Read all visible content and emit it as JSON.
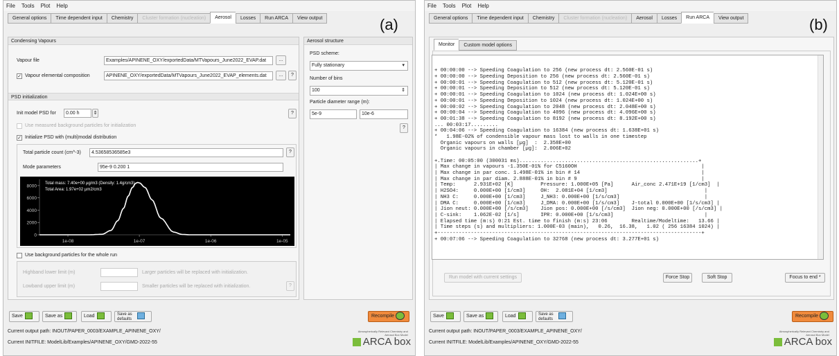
{
  "menu": [
    "File",
    "Tools",
    "Plot",
    "Help"
  ],
  "tabs_a": [
    {
      "label": "General options",
      "state": "normal"
    },
    {
      "label": "Time dependent input",
      "state": "normal"
    },
    {
      "label": "Chemistry",
      "state": "normal"
    },
    {
      "label": "Cluster formation (nucleation)",
      "state": "disabled"
    },
    {
      "label": "Aerosol",
      "state": "active"
    },
    {
      "label": "Losses",
      "state": "normal"
    },
    {
      "label": "Run ARCA",
      "state": "normal"
    },
    {
      "label": "View output",
      "state": "normal"
    }
  ],
  "tabs_b": [
    {
      "label": "General options",
      "state": "normal"
    },
    {
      "label": "Time dependent input",
      "state": "normal"
    },
    {
      "label": "Chemistry",
      "state": "normal"
    },
    {
      "label": "Cluster formation (nucleation)",
      "state": "disabled"
    },
    {
      "label": "Aerosol",
      "state": "normal"
    },
    {
      "label": "Losses",
      "state": "normal"
    },
    {
      "label": "Run ARCA",
      "state": "active"
    },
    {
      "label": "View output",
      "state": "normal"
    }
  ],
  "panel_labels": {
    "a": "(a)",
    "b": "(b)"
  },
  "aerosol": {
    "condensing_title": "Condensing Vapours",
    "vapour_file_label": "Vapour file",
    "vapour_file_value": "Examples/APINENE_OXY/exportedData/MTVapours_June2022_EVAP.dat",
    "vapour_elem_label": "Vapour elemental composition",
    "vapour_elem_value": "APINENE_OXY/exportedData/MTVapours_June2022_EVAP_elements.dat",
    "dots": "...",
    "help": "?",
    "psd_init_title": "PSD initialization",
    "init_model_label": "Init model PSD for",
    "init_model_value": "0.00 h",
    "use_measured": "Use measured background particles for initialization",
    "init_psd": "Initialize PSD with (multi)modal distribution",
    "total_count_label": "Total particle count (cm^-3)",
    "total_count_value": "4.53658536585e3",
    "mode_params_label": "Mode parameters",
    "mode_params_value": "95e-9 0.200 1",
    "use_background": "Use background particles for the whole run",
    "highband_label": "Highband lower limit (m)",
    "highband_note": "Larger particles will be replaced with initialization.",
    "lowband_label": "Lowband upper limit (m)",
    "lowband_note": "Smaller particles will be replaced with initialization.",
    "structure_title": "Aerosol structure",
    "psd_scheme_label": "PSD scheme:",
    "psd_scheme_value": "Fully stationary",
    "bins_label": "Number of bins",
    "bins_value": "100",
    "diam_range_label": "Particle diameter range (m):",
    "diam_min": "5e-9",
    "diam_max": "10e-6"
  },
  "chart_data": {
    "type": "line",
    "x_scale": "log",
    "xticks": [
      "1e-08",
      "1e-07",
      "1e-06",
      "1e-05"
    ],
    "yticks": [
      "0",
      "2000",
      "4000",
      "6000",
      "8000"
    ],
    "ylim": [
      0,
      9000
    ],
    "xlim": [
      4e-09,
      1.3e-05
    ],
    "annotations": [
      "Total mass: 7.40e+00 µg/m3 (Density: 1.4g/cm3)",
      "Total Area: 1.97e+02 µm2/cm3"
    ],
    "series": [
      {
        "x": [
          1e-08,
          2e-08,
          3e-08,
          4e-08,
          5e-08,
          6e-08,
          7e-08,
          8e-08,
          9e-08,
          9.5e-08,
          1e-07,
          1.2e-07,
          1.5e-07,
          2e-07,
          3e-07,
          4e-07,
          5e-07,
          7e-07,
          1e-06
        ],
        "values": [
          0,
          0,
          80,
          700,
          2300,
          4300,
          6300,
          7700,
          8400,
          8500,
          8430,
          7700,
          5700,
          2700,
          450,
          60,
          5,
          0,
          0
        ]
      }
    ],
    "grid": false,
    "background": "#000000",
    "line_color": "#ffffff"
  },
  "monitor": {
    "subtabs": [
      "Monitor",
      "Custom model options"
    ],
    "lines": [
      "+ 00:00:00 --> Speeding Coagulation to 256 (new process dt: 2.560E-01 s)",
      "+ 00:00:00 --> Speeding Deposition to 256 (new process dt: 2.560E-01 s)",
      "+ 00:00:01 --> Speeding Coagulation to 512 (new process dt: 5.120E-01 s)",
      "+ 00:00:01 --> Speeding Deposition to 512 (new process dt: 5.120E-01 s)",
      "+ 00:00:01 --> Speeding Coagulation to 1024 (new process dt: 1.024E+00 s)",
      "+ 00:00:01 --> Speeding Deposition to 1024 (new process dt: 1.024E+00 s)",
      "+ 00:00:02 --> Speeding Coagulation to 2048 (new process dt: 2.048E+00 s)",
      "+ 00:00:04 --> Speeding Coagulation to 4096 (new process dt: 4.096E+00 s)",
      "+ 00:01:38 --> Speeding Coagulation to 8192 (new process dt: 8.192E+00 s)",
      "... 00:03:17.........",
      "+ 00:04:06 --> Speeding Coagulation to 16384 (new process dt: 1.638E+01 s)",
      "*   1.98E-02% of condensible vapour mass lost to walls in one timestep",
      "  Organic vapours on walls [µg]  :  2.358E+00",
      "  Organic vapours in chamber [µg]:  2.006E+02",
      "",
      "+.Time: 00:05:00 (300031 ms)...........................................................+",
      "| Max change in vapours -1.350E-01% for C5160OH                                         |",
      "| Max change in par conc. 1.498E-01% in bin # 14                                        |",
      "| Max change in par diam. 2.888E-01% in bin # 9                                         |",
      "| Temp:      2.931E+02 [K]         Pressure: 1.000E+05 [Pa]      Air_conc 2.471E+19 [1/cm3]  |",
      "| H2SO4:     0.000E+00 [1/cm3]     OH:  2.081E+04 [1/cm3]                                |",
      "| NH3 C:     0.000E+00 [1/cm3]     J_NH3: 0.000E+00 [1/s/cm3]                            |",
      "| DMA C:     0.000E+00 [1/cm3]     J_DMA: 0.000E+00 [1/s/cm3]    J-total 0.000E+00 [1/s/cm3] |",
      "| Jion neut: 0.000E+00 [/s/cm3]    Jion pos: 0.000E+00 [/s/cm3]  Jion neg: 0.000E+00 [/s/cm3] |",
      "| C-sink:    1.062E-02 [1/s]       IPR: 0.000E+00 [1/s/cm3]                              |",
      "| Elapsed time (m:s) 0:21 Est. time to finish (m:s) 23:06        Realtime/Modeltime:   13.66 |",
      "| Time steps (s) and multipliers: 1.000E-03 (main),   0.26,  16.38,   1.02 ( 256 16384 1024) |",
      "+---------------------------------------------------------------------------------------+",
      "+ 00:07:06 --> Speeding Coagulation to 32768 (new process dt: 3.277E+01 s)"
    ],
    "run_button": "Run model with current settings",
    "force_stop": "Force Stop",
    "soft_stop": "Soft Stop",
    "focus_end": "Focus to end *"
  },
  "bottom": {
    "save": "Save",
    "save_as": "Save as",
    "load": "Load",
    "save_defaults": "Save as defaults",
    "recompile": "Recompile",
    "output_path": "Current output path: INOUT/PAPER_0003/EXAMPLE_APINENE_OXY/",
    "initfile": "Current INITFILE: ModelLib/Examples/APINENE_OXY/GMD-2022-55",
    "logo_small": "Atmospherically Relevant Chemistry and Aerosol Box Model",
    "logo_big": "ARCA box"
  }
}
